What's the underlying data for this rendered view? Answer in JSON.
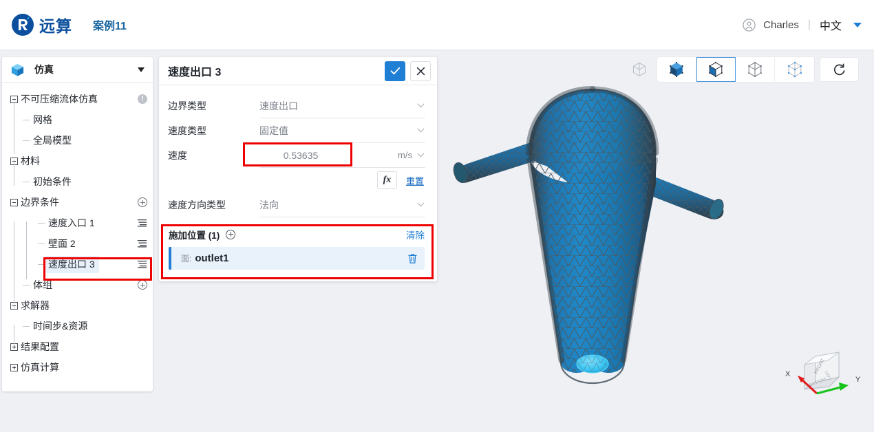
{
  "header": {
    "brand_name": "远算",
    "brand_logo_icon": "yuansuan-logo-icon",
    "project_name": "案例11",
    "user_icon": "user-avatar-icon",
    "user_name": "Charles",
    "separator": "|",
    "language": "中文",
    "language_caret_icon": "caret-down-icon"
  },
  "sidebar": {
    "header": {
      "icon": "cube-icon",
      "label": "仿真",
      "caret_icon": "caret-down-icon"
    },
    "items": [
      {
        "label": "不可压缩流体仿真",
        "depth": 0,
        "toggle": "minus",
        "suffix": "info"
      },
      {
        "label": "网格",
        "depth": 1,
        "toggle": "stub",
        "suffix": "none"
      },
      {
        "label": "全局模型",
        "depth": 1,
        "toggle": "stub",
        "suffix": "none"
      },
      {
        "label": "材料",
        "depth": 0,
        "toggle": "plus",
        "suffix": "none"
      },
      {
        "label": "初始条件",
        "depth": 1,
        "toggle": "stub",
        "suffix": "none"
      },
      {
        "label": "边界条件",
        "depth": 0,
        "toggle": "minus",
        "suffix": "plus"
      },
      {
        "label": "速度入口 1",
        "depth": 2,
        "toggle": "stub",
        "suffix": "menu"
      },
      {
        "label": "壁面 2",
        "depth": 2,
        "toggle": "stub",
        "suffix": "menu"
      },
      {
        "label": "速度出口 3",
        "depth": 2,
        "toggle": "stub",
        "suffix": "menu",
        "selected": true
      },
      {
        "label": "体组",
        "depth": 1,
        "toggle": "stub",
        "suffix": "plus"
      },
      {
        "label": "求解器",
        "depth": 0,
        "toggle": "plus",
        "suffix": "none"
      },
      {
        "label": "时间步&资源",
        "depth": 1,
        "toggle": "stub",
        "suffix": "none"
      },
      {
        "label": "结果配置",
        "depth": 0,
        "toggle": "plus",
        "suffix": "none"
      },
      {
        "label": "仿真计算",
        "depth": 0,
        "toggle": "plus",
        "suffix": "none"
      }
    ]
  },
  "properties": {
    "title": "速度出口 3",
    "confirm_icon": "check-icon",
    "cancel_icon": "close-icon",
    "fields": [
      {
        "label": "边界类型",
        "value": "速度出口",
        "unit": "",
        "chevron_icon": "chevron-down-icon"
      },
      {
        "label": "速度类型",
        "value": "固定值",
        "unit": "",
        "chevron_icon": "chevron-down-icon"
      },
      {
        "label": "速度",
        "value": "0.53635",
        "unit": "m/s",
        "chevron_icon": "chevron-down-icon"
      },
      {
        "label": "速度方向类型",
        "value": "法向",
        "unit": "",
        "chevron_icon": "chevron-down-icon"
      }
    ],
    "fx_button_label": "fx",
    "fx_button_icon": "function-icon",
    "reset_label": "重置",
    "location": {
      "title": "施加位置 (1)",
      "add_icon": "plus-circle-icon",
      "clear_label": "清除",
      "items": [
        {
          "kind": "面:",
          "name": "outlet1",
          "delete_icon": "trash-icon"
        }
      ]
    }
  },
  "viewport": {
    "toolbar": [
      {
        "name": "wireframe-cube-icon",
        "active": false,
        "style": "flat"
      },
      {
        "name": "solid-cube-icon",
        "active": false,
        "style": "group"
      },
      {
        "name": "solid-edges-cube-icon",
        "active": true,
        "style": "group"
      },
      {
        "name": "outline-cube-icon",
        "active": false,
        "style": "group"
      },
      {
        "name": "points-cube-icon",
        "active": false,
        "style": "group"
      },
      {
        "name": "reset-view-icon",
        "active": false,
        "style": "single"
      }
    ],
    "model": {
      "name": "cyclone-separator-mesh",
      "mesh_color": "#1f7fc0",
      "edge_color": "#4a5560",
      "highlight_face": "outlet1",
      "highlight_color": "#3cc8f5"
    },
    "axis_gizmo": {
      "name": "axis-orientation-gizmo",
      "x_label": "X",
      "y_label": "Y",
      "x_color": "#e01b1b",
      "y_color": "#18c41c"
    }
  },
  "annotations": {
    "highlight_color": "#ee0000",
    "boxes": [
      {
        "name": "velocity-value-highlight"
      },
      {
        "name": "applied-location-highlight"
      },
      {
        "name": "tree-selected-node-highlight"
      }
    ]
  }
}
